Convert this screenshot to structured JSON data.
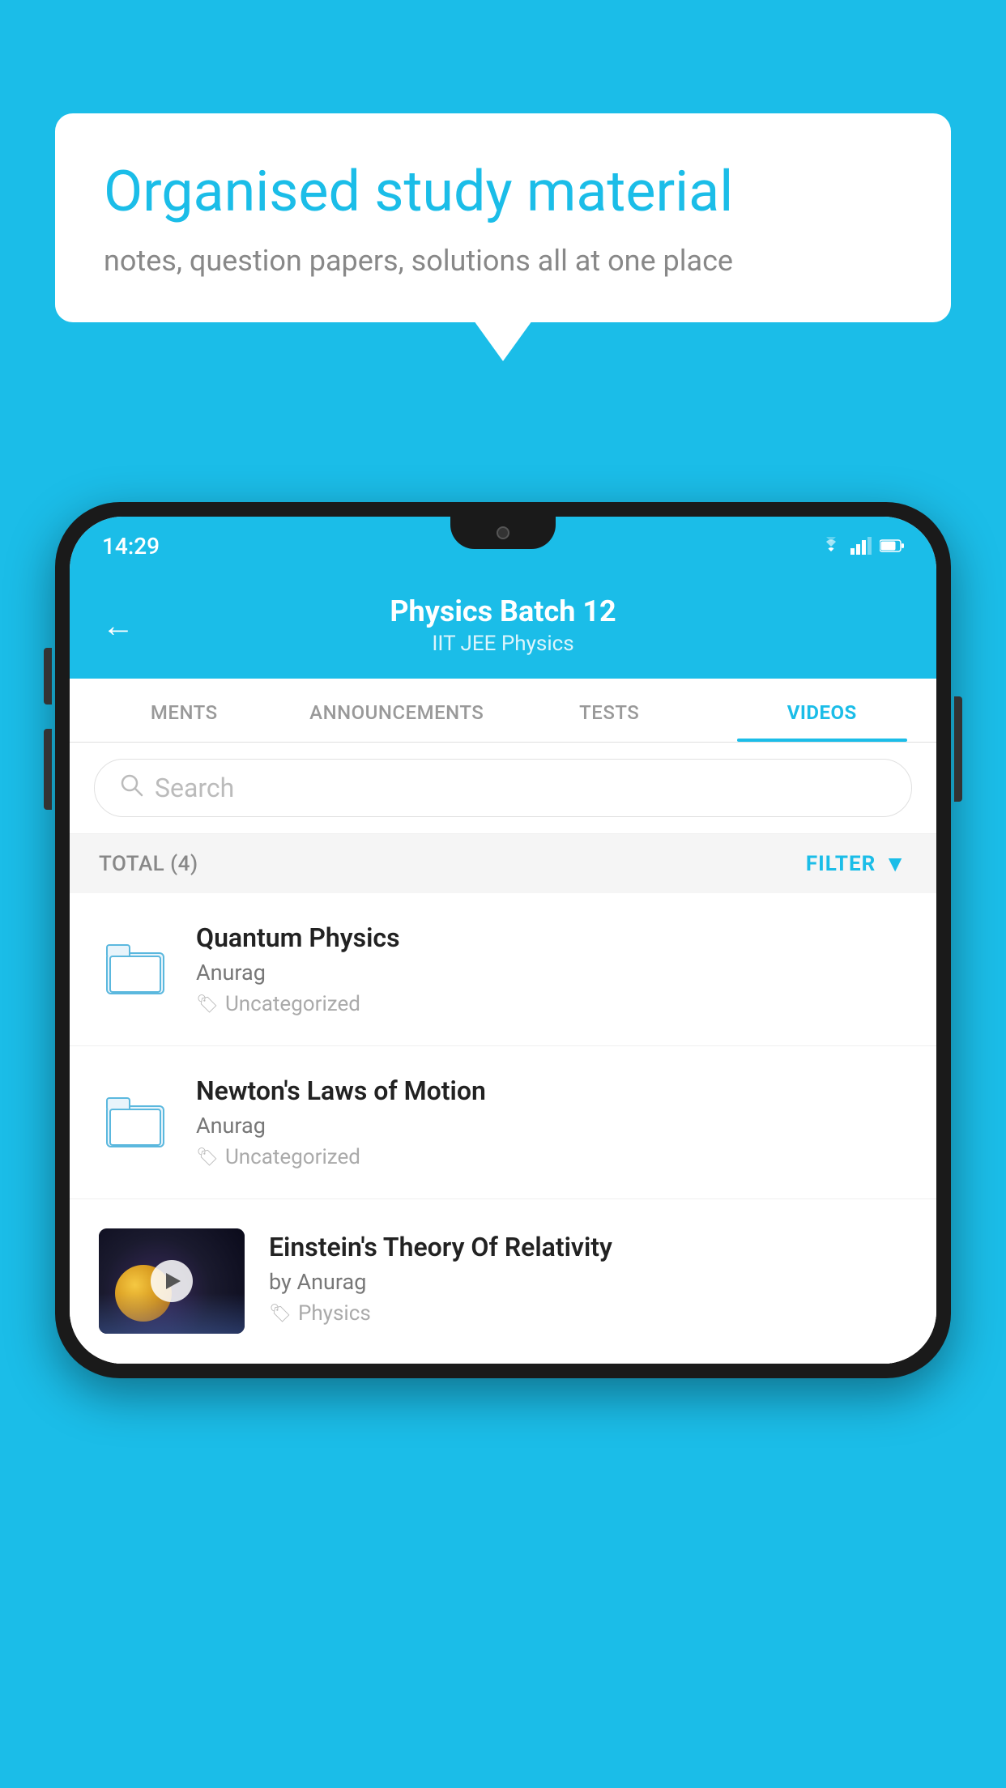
{
  "background_color": "#1BBDE8",
  "bubble": {
    "title": "Organised study material",
    "subtitle": "notes, question papers, solutions all at one place"
  },
  "phone": {
    "status_bar": {
      "time": "14:29"
    },
    "header": {
      "back_label": "←",
      "batch_name": "Physics Batch 12",
      "tags": "IIT JEE   Physics"
    },
    "tabs": [
      {
        "label": "MENTS",
        "active": false
      },
      {
        "label": "ANNOUNCEMENTS",
        "active": false
      },
      {
        "label": "TESTS",
        "active": false
      },
      {
        "label": "VIDEOS",
        "active": true
      }
    ],
    "search": {
      "placeholder": "Search"
    },
    "filter_bar": {
      "total": "TOTAL (4)",
      "filter_label": "FILTER"
    },
    "list_items": [
      {
        "title": "Quantum Physics",
        "author": "Anurag",
        "tag": "Uncategorized",
        "has_thumbnail": false
      },
      {
        "title": "Newton's Laws of Motion",
        "author": "Anurag",
        "tag": "Uncategorized",
        "has_thumbnail": false
      },
      {
        "title": "Einstein's Theory Of Relativity",
        "author": "by Anurag",
        "tag": "Physics",
        "has_thumbnail": true
      }
    ]
  }
}
